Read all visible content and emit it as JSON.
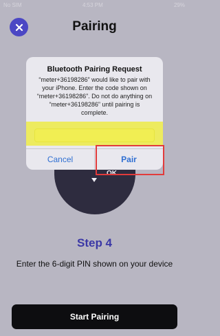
{
  "status": {
    "left": "No SIM",
    "center": "4:53 PM",
    "right": "29%"
  },
  "header": {
    "title": "Pairing",
    "close_icon": "close-icon"
  },
  "device": {
    "label": "OK"
  },
  "alert": {
    "title": "Bluetooth Pairing Request",
    "message": "“meter+36198286” would like to pair with your iPhone. Enter the code shown on “meter+36198286”. Do not do anything on “meter+36198286” until pairing is complete.",
    "input_value": "",
    "cancel_label": "Cancel",
    "pair_label": "Pair"
  },
  "step": {
    "title": "Step 4",
    "description": "Enter the 6-digit PIN shown on your device"
  },
  "footer": {
    "start_label": "Start Pairing"
  },
  "colors": {
    "accent": "#4b47c4",
    "step": "#3b38a6",
    "button_bg": "#0d0d10",
    "ios_blue": "#2f6fd2",
    "highlight": "#eeec28",
    "annotation": "#e23b3b"
  }
}
